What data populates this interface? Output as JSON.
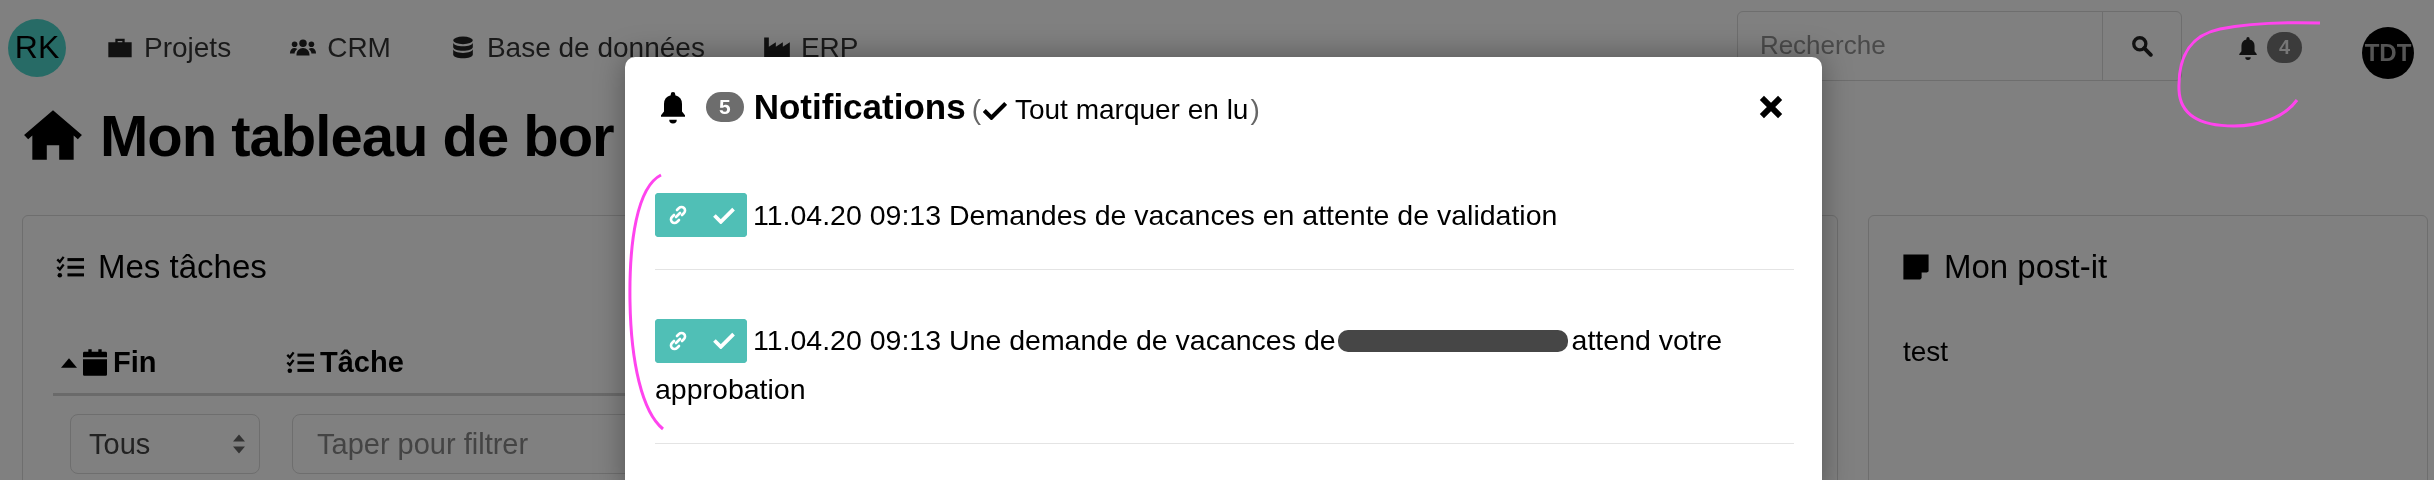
{
  "navbar": {
    "avatar": "RK",
    "links": [
      {
        "label": "Projets"
      },
      {
        "label": "CRM"
      },
      {
        "label": "Base de données"
      },
      {
        "label": "ERP"
      }
    ],
    "search": {
      "placeholder": "Recherche"
    },
    "notification_count": "4",
    "user_avatar": "TDT"
  },
  "page_title": "Mon tableau de bor",
  "tasks_card": {
    "title": "Mes tâches",
    "columns": [
      {
        "label": "Fin",
        "sorted": true
      },
      {
        "label": "Tâche",
        "sorted": false
      }
    ],
    "status_filter": {
      "value": "Tous"
    },
    "task_filter": {
      "placeholder": "Taper pour filtrer"
    }
  },
  "postit_card": {
    "title": "Mon post-it",
    "text": "test"
  },
  "modal": {
    "count": "5",
    "title": "Notifications",
    "mark_all": {
      "open": "(",
      "label": "Tout marquer en lu",
      "close": ")"
    },
    "items": [
      {
        "time": "11.04.20 09:13",
        "text": "Demandes de vacances en attente de validation"
      },
      {
        "time": "11.04.20 09:13",
        "text": "Une demande de vacances de",
        "redacted": true,
        "text_after": "attend votre",
        "text_next_line": "approbation"
      }
    ]
  }
}
